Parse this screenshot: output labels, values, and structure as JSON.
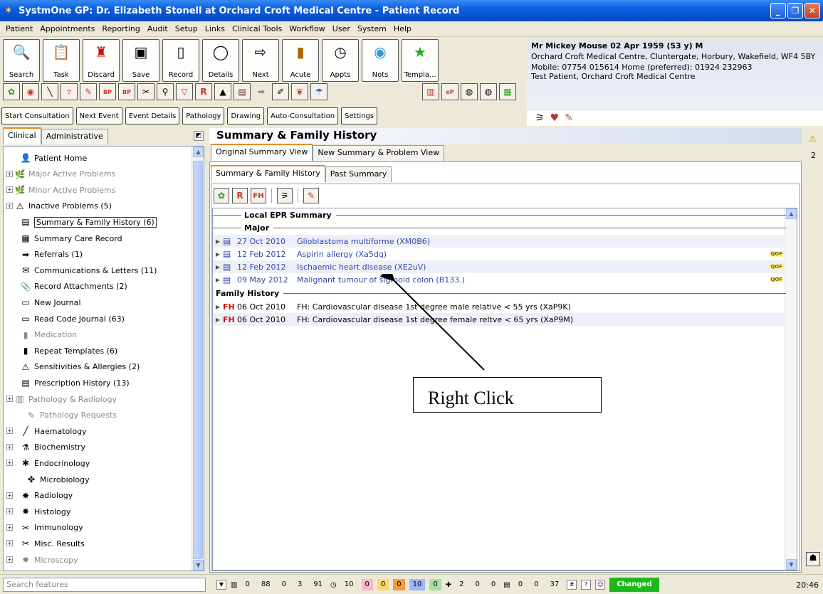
{
  "window": {
    "title": "SystmOne GP: Dr. Elizabeth Stonell at Orchard Croft Medical Centre - Patient Record"
  },
  "menu": [
    "Patient",
    "Appointments",
    "Reporting",
    "Audit",
    "Setup",
    "Links",
    "Clinical Tools",
    "Workflow",
    "User",
    "System",
    "Help"
  ],
  "toolbar": [
    {
      "label": "Search",
      "icon": "magnifier-icon"
    },
    {
      "label": "Task",
      "icon": "task-icon"
    },
    {
      "label": "Discard",
      "icon": "discard-icon"
    },
    {
      "label": "Save",
      "icon": "floppy-icon"
    },
    {
      "label": "Record",
      "icon": "record-icon"
    },
    {
      "label": "Details",
      "icon": "circle-icon"
    },
    {
      "label": "Next",
      "icon": "next-icon"
    },
    {
      "label": "Acute",
      "icon": "bottle-icon"
    },
    {
      "label": "Appts",
      "icon": "clock-icon"
    },
    {
      "label": "Nots",
      "icon": "notes-icon"
    },
    {
      "label": "Templa...",
      "icon": "star-icon"
    }
  ],
  "consult_buttons": [
    "Start Consultation",
    "Next Event",
    "Event Details",
    "Pathology",
    "Drawing",
    "Auto-Consultation",
    "Settings"
  ],
  "patient": {
    "name_line": "Mr Mickey Mouse 02 Apr 1959 (53 y) M",
    "address": "Orchard Croft Medical Centre, Cluntergate, Horbury, Wakefield, WF4 5BY",
    "phone": "Mobile: 07754 015614 Home (preferred): 01924 232963",
    "info": "Test Patient, Orchard Croft Medical Centre"
  },
  "left_tabs": [
    "Clinical",
    "Administrative"
  ],
  "tree": [
    {
      "label": "Patient Home",
      "icon": "👤",
      "depth": 1,
      "gray": false,
      "exp": false
    },
    {
      "label": "Major Active Problems",
      "icon": "🌿",
      "depth": 0,
      "gray": true,
      "exp": true
    },
    {
      "label": "Minor Active Problems",
      "icon": "🌿",
      "depth": 0,
      "gray": true,
      "exp": true
    },
    {
      "label": "Inactive Problems (5)",
      "icon": "⚠",
      "depth": 0,
      "gray": false,
      "exp": true
    },
    {
      "label": "Summary & Family History (6)",
      "icon": "▤",
      "depth": 1,
      "gray": false,
      "exp": false,
      "selected": true
    },
    {
      "label": "Summary Care Record",
      "icon": "▦",
      "depth": 1,
      "gray": false,
      "exp": false
    },
    {
      "label": "Referrals (1)",
      "icon": "➡",
      "depth": 1,
      "gray": false,
      "exp": false
    },
    {
      "label": "Communications & Letters (11)",
      "icon": "✉",
      "depth": 1,
      "gray": false,
      "exp": false
    },
    {
      "label": "Record Attachments (2)",
      "icon": "📎",
      "depth": 1,
      "gray": false,
      "exp": false
    },
    {
      "label": "New Journal",
      "icon": "▭",
      "depth": 1,
      "gray": false,
      "exp": false
    },
    {
      "label": "Read Code Journal (63)",
      "icon": "▭",
      "depth": 1,
      "gray": false,
      "exp": false
    },
    {
      "label": "Medication",
      "icon": "▮",
      "depth": 1,
      "gray": true,
      "exp": false
    },
    {
      "label": "Repeat Templates (6)",
      "icon": "▮",
      "depth": 1,
      "gray": false,
      "exp": false
    },
    {
      "label": "Sensitivities & Allergies (2)",
      "icon": "⚠",
      "depth": 1,
      "gray": false,
      "exp": false
    },
    {
      "label": "Prescription History (13)",
      "icon": "▤",
      "depth": 1,
      "gray": false,
      "exp": false
    },
    {
      "label": "Pathology & Radiology",
      "icon": "▥",
      "depth": 0,
      "gray": true,
      "exp": true
    },
    {
      "label": "Pathology Requests",
      "icon": "✎",
      "depth": 2,
      "gray": true,
      "exp": false
    },
    {
      "label": "Haematology",
      "icon": "╱",
      "depth": 1,
      "gray": false,
      "exp": true
    },
    {
      "label": "Biochemistry",
      "icon": "⚗",
      "depth": 1,
      "gray": false,
      "exp": true
    },
    {
      "label": "Endocrinology",
      "icon": "✱",
      "depth": 1,
      "gray": false,
      "exp": true
    },
    {
      "label": "Microbiology",
      "icon": "✤",
      "depth": 2,
      "gray": false,
      "exp": false
    },
    {
      "label": "Radiology",
      "icon": "✸",
      "depth": 1,
      "gray": false,
      "exp": true
    },
    {
      "label": "Histology",
      "icon": "✸",
      "depth": 1,
      "gray": false,
      "exp": true
    },
    {
      "label": "Immunology",
      "icon": "✂",
      "depth": 1,
      "gray": false,
      "exp": true
    },
    {
      "label": "Misc. Results",
      "icon": "✂",
      "depth": 1,
      "gray": false,
      "exp": true
    },
    {
      "label": "Microscopy",
      "icon": "✸",
      "depth": 1,
      "gray": true,
      "exp": true
    }
  ],
  "main": {
    "title": "Summary & Family History",
    "tabs": [
      "Original Summary View",
      "New Summary & Problem View"
    ],
    "subtabs": [
      "Summary & Family History",
      "Past Summary"
    ],
    "sections": {
      "local": "Local EPR Summary",
      "major": "Major",
      "family": "Family History"
    },
    "major_rows": [
      {
        "date": "27 Oct 2010",
        "desc": "Glioblastoma multiforme (XM0B6)",
        "qof": ""
      },
      {
        "date": "12 Feb 2012",
        "desc": "Aspirin allergy (Xa5dq)",
        "qof": "QOF"
      },
      {
        "date": "12 Feb 2012",
        "desc": "Ischaemic heart disease (XE2uV)",
        "qof": "QOF"
      },
      {
        "date": "09 May 2012",
        "desc": "Malignant tumour of sigmoid colon (B133.)",
        "qof": "QOF"
      }
    ],
    "family_rows": [
      {
        "tag": "FH",
        "date": "06 Oct 2010",
        "desc": "FH: Cardiovascular disease 1st degree male relative < 55 yrs (XaP9K)"
      },
      {
        "tag": "FH",
        "date": "06 Oct 2010",
        "desc": "FH: Cardiovascular disease 1st degree female reltve < 65 yrs (XaP9M)"
      }
    ]
  },
  "callout": {
    "text": "Right Click"
  },
  "right_strip": {
    "count": "2"
  },
  "status": {
    "search_placeholder": "Search features",
    "counts_a": [
      "0",
      "88",
      "0",
      "3",
      "91"
    ],
    "counts_b": [
      "10",
      "0",
      "0",
      "0",
      "10",
      "0"
    ],
    "counts_c": [
      "2",
      "0",
      "0"
    ],
    "counts_d": [
      "0",
      "0",
      "37"
    ],
    "changed": "Changed",
    "time": "20:46"
  }
}
